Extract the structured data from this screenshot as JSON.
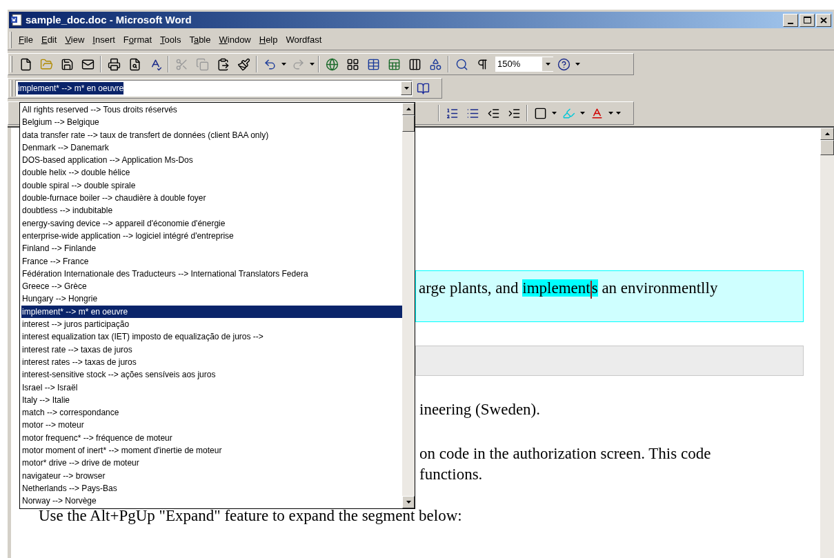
{
  "window": {
    "title": "sample_doc.doc - Microsoft Word"
  },
  "menu": [
    {
      "access_key": "F",
      "rest": "ile"
    },
    {
      "access_key": "E",
      "rest": "dit"
    },
    {
      "access_key": "V",
      "rest": "iew"
    },
    {
      "access_key": "I",
      "rest": "nsert"
    },
    {
      "before": "F",
      "access_key": "o",
      "rest": "rmat"
    },
    {
      "access_key": "T",
      "rest": "ools"
    },
    {
      "before": "T",
      "access_key": "a",
      "rest": "ble"
    },
    {
      "access_key": "W",
      "rest": "indow"
    },
    {
      "access_key": "H",
      "rest": "elp"
    },
    {
      "rest": "Wordfast"
    }
  ],
  "standard_toolbar": {
    "zoom": "150%"
  },
  "wordfast_toolbar": {
    "term_combo": {
      "value": "implement*  -->  m* en oeuvre"
    }
  },
  "term_list": [
    {
      "text": "All rights reserved  -->  Tous droits réservés",
      "selected": false
    },
    {
      "text": "Belgium  -->  Belgique",
      "selected": false
    },
    {
      "text": "data transfer rate  -->  taux de transfert de données  (client BAA only)",
      "selected": false
    },
    {
      "text": "Denmark  -->  Danemark",
      "selected": false
    },
    {
      "text": "DOS-based application  -->  Application Ms-Dos",
      "selected": false
    },
    {
      "text": "double helix  -->  double hélice",
      "selected": false
    },
    {
      "text": "double spiral  -->  double spirale",
      "selected": false
    },
    {
      "text": "double-furnace boiler  -->  chaudière à double foyer",
      "selected": false
    },
    {
      "text": "doubtless  -->  indubitable",
      "selected": false
    },
    {
      "text": "energy-saving device  -->  appareil d'économie d'énergie",
      "selected": false
    },
    {
      "text": "enterprise-wide application  -->  logiciel intégré d'entreprise",
      "selected": false
    },
    {
      "text": "Finland  -->  Finlande",
      "selected": false
    },
    {
      "text": "France  -->  France",
      "selected": false
    },
    {
      "text": "Fédération Internationale des Traducteurs  -->  International Translators Federa",
      "selected": false
    },
    {
      "text": "Greece  -->  Grèce",
      "selected": false
    },
    {
      "text": "Hungary  -->  Hongrie",
      "selected": false
    },
    {
      "text": "implement*  -->  m* en oeuvre",
      "selected": true
    },
    {
      "text": "interest  -->  juros participação",
      "selected": false
    },
    {
      "text": "interest equalization tax (IET) imposto de equalização de juros  -->",
      "selected": false
    },
    {
      "text": "interest rate  -->  taxas de juros",
      "selected": false
    },
    {
      "text": "interest rates  -->  taxas de juros",
      "selected": false
    },
    {
      "text": "interest-sensitive stock  -->  ações sensíveis aos juros",
      "selected": false
    },
    {
      "text": "Israel  -->  Israël",
      "selected": false
    },
    {
      "text": "Italy  -->  Italie",
      "selected": false
    },
    {
      "text": "match  -->  correspondance",
      "selected": false
    },
    {
      "text": "motor  -->  moteur",
      "selected": false
    },
    {
      "text": "motor frequenc*  -->  fréquence de moteur",
      "selected": false
    },
    {
      "text": "motor moment of inert*  -->  moment d'inertie de moteur",
      "selected": false
    },
    {
      "text": "motor* drive  -->  drive de moteur",
      "selected": false
    },
    {
      "text": "navigateur  -->  browser",
      "selected": false
    },
    {
      "text": "Netherlands  -->  Pays-Bas",
      "selected": false
    },
    {
      "text": "Norway  -->  Norvège",
      "selected": false
    }
  ],
  "document": {
    "paragraphs": [
      {
        "kind": "open_segment",
        "segments": [
          {
            "text": "arge plants, and ",
            "highlighted": false,
            "caret_after": false
          },
          {
            "text": "implement",
            "highlighted": true,
            "caret_after": true
          },
          {
            "text": "s",
            "highlighted": true,
            "caret_after": false
          },
          {
            "text": " an environmentlly",
            "highlighted": false,
            "caret_after": false
          }
        ]
      },
      {
        "kind": "target_segment"
      },
      {
        "kind": "partial_text",
        "lines": [
          "ineering (Sweden)."
        ]
      },
      {
        "kind": "partial_text",
        "lines": [
          "on code in the authorization screen. This code",
          "functions."
        ]
      },
      {
        "kind": "full_text",
        "lines": [
          "Use the Alt+PgUp \"Expand\" feature to expand the segment below:"
        ]
      }
    ]
  }
}
